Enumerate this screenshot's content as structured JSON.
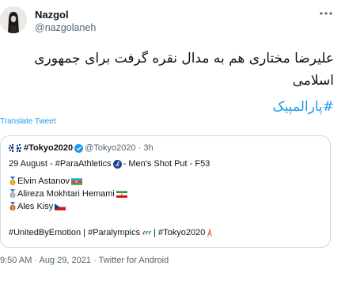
{
  "author": {
    "display_name": "Nazgol",
    "handle": "@nazgolaneh"
  },
  "tweet": {
    "text": "علیرضا مختاری هم به مدال نقره گرفت برای جمهوری اسلامی",
    "hashtag": "#پارالمپیک",
    "translate_label": "Translate Tweet"
  },
  "quoted_tweet": {
    "name": "#Tokyo2020",
    "handle": "@Tokyo2020",
    "separator": "·",
    "time": "3h",
    "line1_before": "29 August - #ParaAthletics",
    "line1_after": "- Men's Shot Put - F53",
    "athletes": [
      {
        "name": "Elvin Astanov",
        "medal": "gold",
        "country": "Azerbaijan"
      },
      {
        "name": "Alireza Mokhtari Hemami",
        "medal": "silver",
        "country": "Iran"
      },
      {
        "name": "Ales Kisy",
        "medal": "bronze",
        "country": "Czech Republic"
      }
    ],
    "tags_part1": "#UnitedByEmotion | #Paralympics",
    "tags_part2": "| #Tokyo2020"
  },
  "footer": {
    "time": "9:50 AM",
    "separator": "·",
    "date": "Aug 29, 2021",
    "separator2": "·",
    "client": "Twitter for Android"
  },
  "colors": {
    "link": "#1d9bf0",
    "secondary_text": "#536471",
    "border": "#cfd9de",
    "gold": "#d9a520",
    "silver": "#a8adb3",
    "bronze": "#b9733a"
  }
}
